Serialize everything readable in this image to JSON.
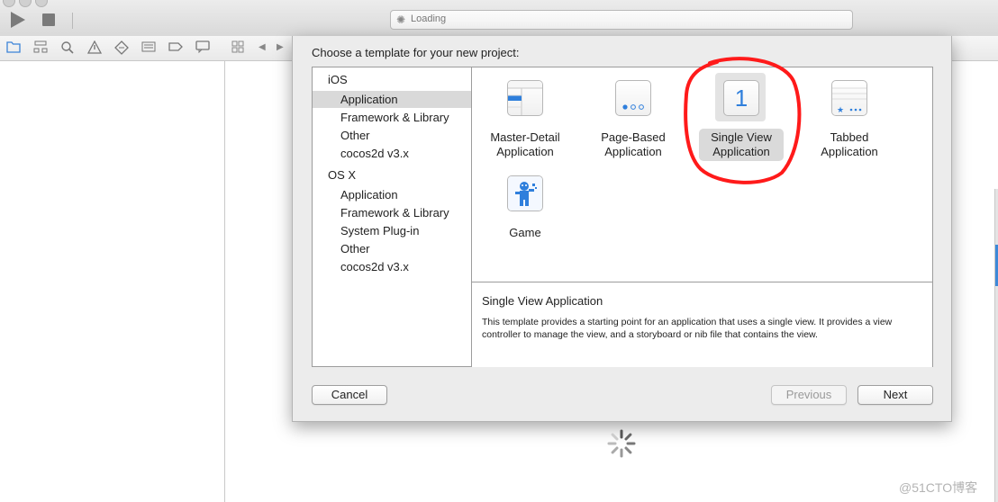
{
  "toolbar": {
    "activity_text": "Loading",
    "run_icon": "play-icon",
    "stop_icon": "stop-icon"
  },
  "navigator_icons": [
    "folder-icon",
    "hierarchy-icon",
    "search-icon",
    "warning-icon",
    "test-diamond-icon",
    "list-icon",
    "tag-icon",
    "message-icon"
  ],
  "sheet": {
    "title": "Choose a template for your new project:",
    "categories": [
      {
        "heading": "iOS",
        "items": [
          "Application",
          "Framework & Library",
          "Other",
          "cocos2d v3.x"
        ]
      },
      {
        "heading": "OS X",
        "items": [
          "Application",
          "Framework & Library",
          "System Plug-in",
          "Other",
          "cocos2d v3.x"
        ]
      }
    ],
    "selected_category": "iOS / Application",
    "templates": [
      {
        "line1": "Master-Detail",
        "line2": "Application",
        "icon": "master-detail-icon"
      },
      {
        "line1": "Page-Based",
        "line2": "Application",
        "icon": "page-based-icon"
      },
      {
        "line1": "Single View",
        "line2": "Application",
        "icon": "single-view-icon",
        "icon_glyph": "1"
      },
      {
        "line1": "Tabbed",
        "line2": "Application",
        "icon": "tabbed-icon"
      },
      {
        "line1": "Game",
        "line2": "",
        "icon": "game-icon"
      }
    ],
    "selected_template": "Single View Application",
    "description_title": "Single View Application",
    "description_body": "This template provides a starting point for an application that uses a single view. It provides a view controller to manage the view, and a storyboard or nib file that contains the view.",
    "buttons": {
      "cancel": "Cancel",
      "previous": "Previous",
      "next": "Next"
    }
  },
  "colors": {
    "accent": "#3b83d8",
    "annotation": "#ff1a1a"
  },
  "watermark": "@51CTO博客"
}
